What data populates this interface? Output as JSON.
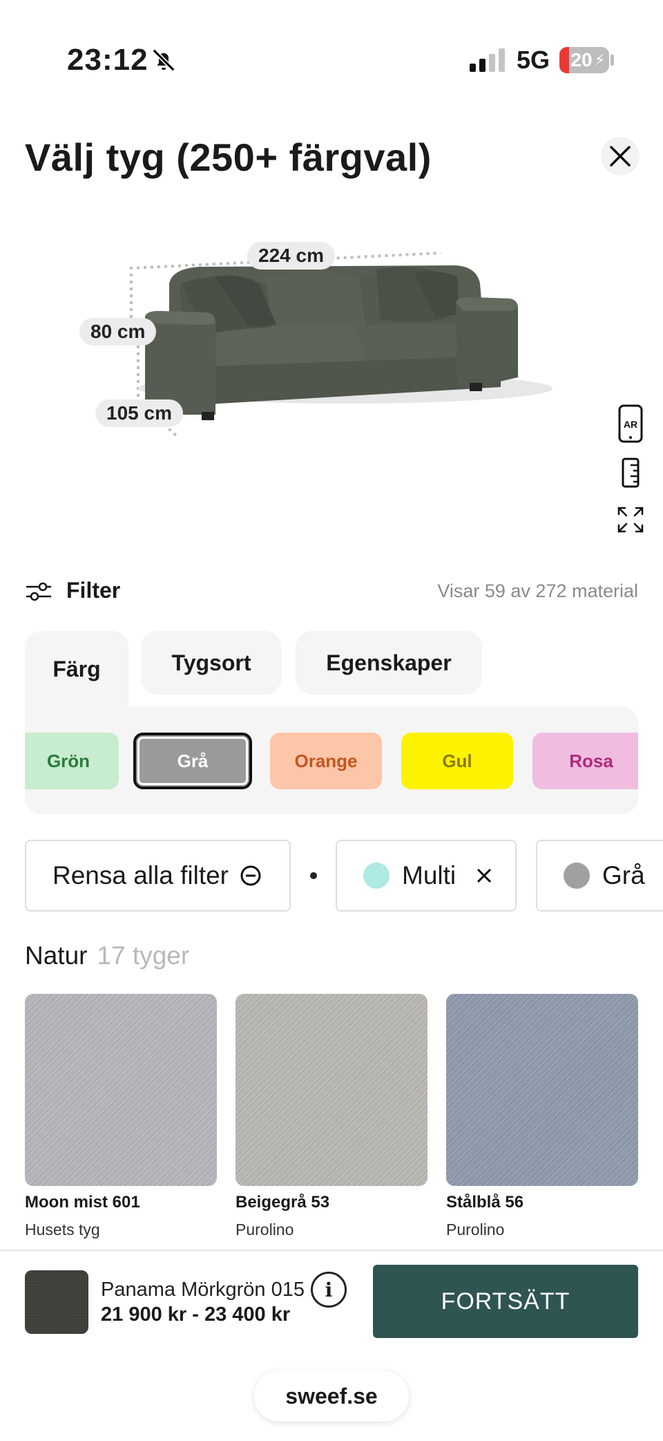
{
  "status_bar": {
    "time": "23:12",
    "network": "5G",
    "battery": "20",
    "battery_level": 0.2,
    "icons": [
      "bell-muted-icon",
      "signal-icon",
      "battery-charging-icon"
    ]
  },
  "header": {
    "title": "Välj tyg (250+ färgval)",
    "close_icon": "close-icon"
  },
  "product_preview": {
    "dimensions": {
      "width": "224 cm",
      "height": "80 cm",
      "depth": "105 cm"
    },
    "sofa_color": "#4a5046",
    "tools": [
      {
        "name": "ar-view",
        "label": "AR",
        "icon": "ar-phone-icon"
      },
      {
        "name": "measure",
        "icon": "ruler-icon"
      },
      {
        "name": "fullscreen",
        "icon": "expand-icon"
      }
    ]
  },
  "filter_bar": {
    "label": "Filter",
    "count_text": "Visar 59 av 272 material",
    "icon": "sliders-icon"
  },
  "tabs": [
    {
      "label": "Färg",
      "active": true
    },
    {
      "label": "Tygsort",
      "active": false
    },
    {
      "label": "Egenskaper",
      "active": false
    }
  ],
  "color_chips": [
    {
      "label": "Grön",
      "bg": "#c8ecd0",
      "fg": "#2a7a3a",
      "selected": false
    },
    {
      "label": "Grå",
      "bg": "#9a9a9a",
      "fg": "#ffffff",
      "selected": true
    },
    {
      "label": "Orange",
      "bg": "#fcc6a9",
      "fg": "#c4561e",
      "selected": false
    },
    {
      "label": "Gul",
      "bg": "#fdf300",
      "fg": "#8c7a00",
      "selected": false
    },
    {
      "label": "Rosa",
      "bg": "#f0bde0",
      "fg": "#b02a7a",
      "selected": false
    }
  ],
  "active_filters": {
    "clear_label": "Rensa alla filter",
    "clear_icon": "minus-circle-icon",
    "items": [
      {
        "label": "Multi",
        "color": "#aee9e3",
        "remove_icon": "close-icon"
      },
      {
        "label": "Grå",
        "color": "#a0a0a0",
        "remove_icon": "close-icon"
      }
    ]
  },
  "section": {
    "title": "Natur",
    "count": "17 tyger"
  },
  "products": [
    {
      "name": "Moon mist 601",
      "brand": "Husets tyg",
      "color": "#b7b6bc"
    },
    {
      "name": "Beigegrå 53",
      "brand": "Purolino",
      "color": "#bab8b2"
    },
    {
      "name": "Stålblå 56",
      "brand": "Purolino",
      "color": "#8e9aad"
    }
  ],
  "selection": {
    "name": "Panama Mörkgrön 015",
    "price": "21 900 kr - 23 400 kr",
    "info_label": "i",
    "continue_label": "FORTSÄTT",
    "accent": "#2f5553"
  },
  "footer": {
    "domain": "sweef.se"
  }
}
